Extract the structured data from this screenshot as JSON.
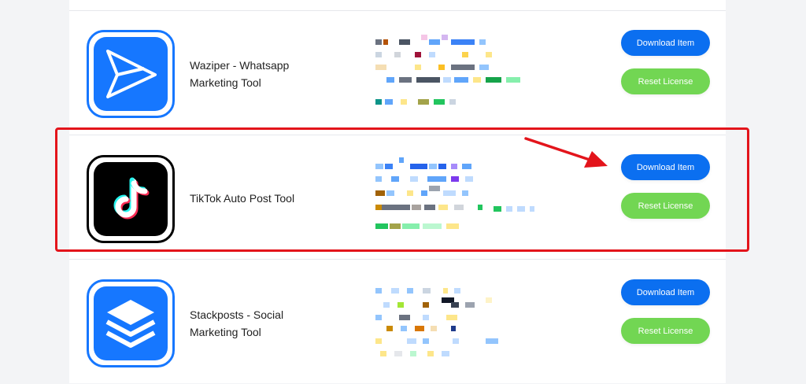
{
  "items": [
    {
      "title_line1": "Waziper - Whatsapp",
      "title_line2": "Marketing Tool",
      "icon": "send-icon",
      "download_label": "Download Item",
      "reset_label": "Reset License"
    },
    {
      "title_line1": "TikTok Auto Post Tool",
      "title_line2": "",
      "icon": "tiktok-icon",
      "download_label": "Download Item",
      "reset_label": "Reset License"
    },
    {
      "title_line1": "Stackposts - Social",
      "title_line2": "Marketing Tool",
      "icon": "layers-icon",
      "download_label": "Download Item",
      "reset_label": "Reset License"
    }
  ],
  "colors": {
    "brand_blue": "#0b6ff0",
    "reset_green": "#72d653",
    "annotation_red": "#e3141b"
  }
}
